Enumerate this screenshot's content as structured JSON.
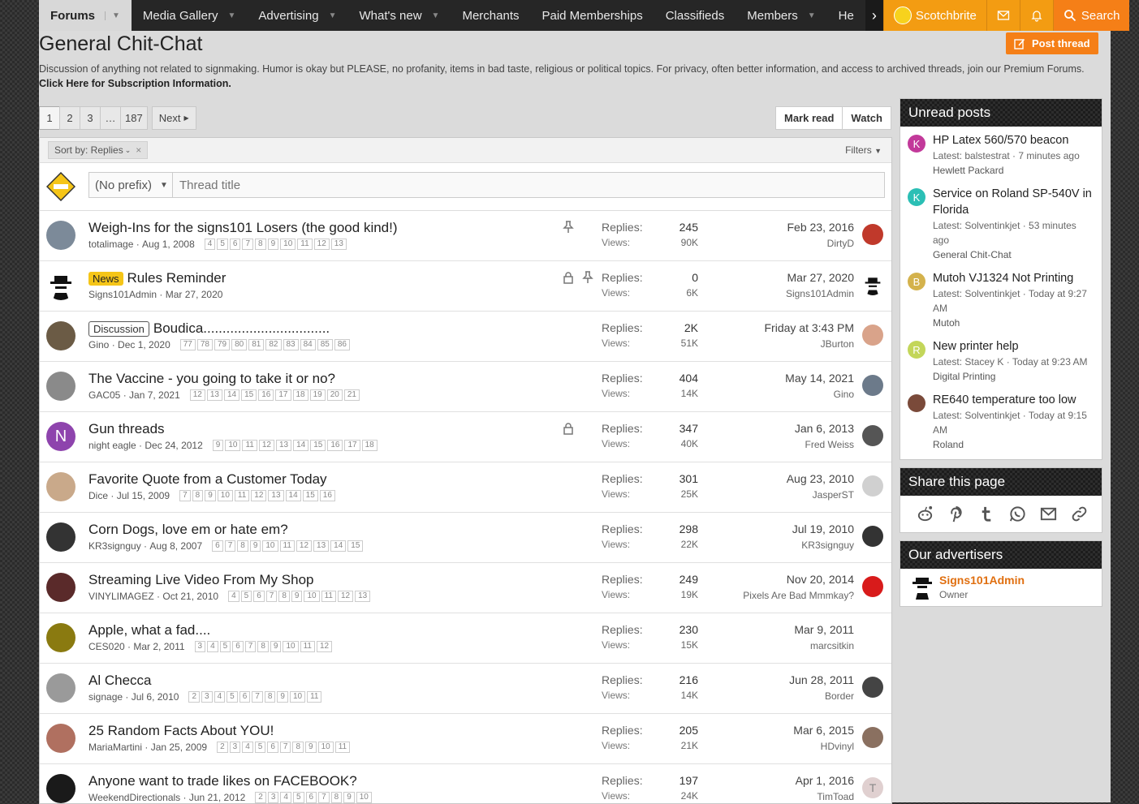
{
  "nav": {
    "tabs": [
      {
        "label": "Forums",
        "caret": true
      },
      {
        "label": "Media Gallery",
        "caret": true
      },
      {
        "label": "Advertising",
        "caret": true
      },
      {
        "label": "What's new",
        "caret": true
      },
      {
        "label": "Merchants",
        "caret": false
      },
      {
        "label": "Paid Memberships",
        "caret": false
      },
      {
        "label": "Classifieds",
        "caret": false
      },
      {
        "label": "Members",
        "caret": true
      },
      {
        "label": "He",
        "caret": false
      }
    ],
    "user": "Scotchbrite",
    "search_label": "Search",
    "accent_color": "#f39c12"
  },
  "page": {
    "title": "General Chit-Chat",
    "post_thread_label": "Post thread",
    "description": "Discussion of anything not related to signmaking. Humor is okay but PLEASE, no profanity, items in bad taste, religious or political topics. For privacy, often better information, and access to archived threads, join our Premium Forums.",
    "description_link": "Click Here for Subscription Information."
  },
  "pager": {
    "pages": [
      "1",
      "2",
      "3",
      "…",
      "187"
    ],
    "next_label": "Next"
  },
  "actions": {
    "mark_read": "Mark read",
    "watch": "Watch"
  },
  "filter_bar": {
    "sort_label": "Sort by: Replies",
    "filters_label": "Filters"
  },
  "quick_thread": {
    "prefix": "(No prefix)",
    "placeholder": "Thread title"
  },
  "stats_labels": {
    "replies": "Replies:",
    "views": "Views:"
  },
  "threads": [
    {
      "title": "Weigh-Ins for the signs101 Losers (the good kind!)",
      "label": "",
      "author": "totalimage",
      "date": "Aug 1, 2008",
      "pages": [
        "4",
        "5",
        "6",
        "7",
        "8",
        "9",
        "10",
        "11",
        "12",
        "13"
      ],
      "replies": "245",
      "views": "90K",
      "last_date": "Feb 23, 2016",
      "last_user": "DirtyD",
      "sticky": true,
      "locked": false,
      "avatar_color": "#7c8a99",
      "last_av_color": "#c0392b",
      "avatar_letter": "",
      "last_av_letter": ""
    },
    {
      "title": "Rules Reminder",
      "label": "News",
      "author": "Signs101Admin",
      "date": "Mar 27, 2020",
      "pages": [],
      "replies": "0",
      "views": "6K",
      "last_date": "Mar 27, 2020",
      "last_user": "Signs101Admin",
      "sticky": true,
      "locked": true,
      "avatar_color": "#ffffff",
      "last_av_color": "#ffffff",
      "avatar_letter": "",
      "last_av_letter": ""
    },
    {
      "title": "Boudica.................................",
      "label": "Discussion",
      "author": "Gino",
      "date": "Dec 1, 2020",
      "pages": [
        "77",
        "78",
        "79",
        "80",
        "81",
        "82",
        "83",
        "84",
        "85",
        "86"
      ],
      "replies": "2K",
      "views": "51K",
      "last_date": "Friday at 3:43 PM",
      "last_user": "JBurton",
      "sticky": false,
      "locked": false,
      "avatar_color": "#6b5b45",
      "last_av_color": "#d9a38a",
      "avatar_letter": "",
      "last_av_letter": ""
    },
    {
      "title": "The Vaccine - you going to take it or no?",
      "label": "",
      "author": "GAC05",
      "date": "Jan 7, 2021",
      "pages": [
        "12",
        "13",
        "14",
        "15",
        "16",
        "17",
        "18",
        "19",
        "20",
        "21"
      ],
      "replies": "404",
      "views": "14K",
      "last_date": "May 14, 2021",
      "last_user": "Gino",
      "sticky": false,
      "locked": false,
      "avatar_color": "#8a8a8a",
      "last_av_color": "#6c7a8a",
      "avatar_letter": "",
      "last_av_letter": ""
    },
    {
      "title": "Gun threads",
      "label": "",
      "author": "night eagle",
      "date": "Dec 24, 2012",
      "pages": [
        "9",
        "10",
        "11",
        "12",
        "13",
        "14",
        "15",
        "16",
        "17",
        "18"
      ],
      "replies": "347",
      "views": "40K",
      "last_date": "Jan 6, 2013",
      "last_user": "Fred Weiss",
      "sticky": false,
      "locked": true,
      "avatar_color": "#8e44ad",
      "last_av_color": "#555555",
      "avatar_letter": "N",
      "last_av_letter": ""
    },
    {
      "title": "Favorite Quote from a Customer Today",
      "label": "",
      "author": "Dice",
      "date": "Jul 15, 2009",
      "pages": [
        "7",
        "8",
        "9",
        "10",
        "11",
        "12",
        "13",
        "14",
        "15",
        "16"
      ],
      "replies": "301",
      "views": "25K",
      "last_date": "Aug 23, 2010",
      "last_user": "JasperST",
      "sticky": false,
      "locked": false,
      "avatar_color": "#c9a98a",
      "last_av_color": "#d0d0d0",
      "avatar_letter": "",
      "last_av_letter": ""
    },
    {
      "title": "Corn Dogs, love em or hate em?",
      "label": "",
      "author": "KR3signguy",
      "date": "Aug 8, 2007",
      "pages": [
        "6",
        "7",
        "8",
        "9",
        "10",
        "11",
        "12",
        "13",
        "14",
        "15"
      ],
      "replies": "298",
      "views": "22K",
      "last_date": "Jul 19, 2010",
      "last_user": "KR3signguy",
      "sticky": false,
      "locked": false,
      "avatar_color": "#333333",
      "last_av_color": "#333333",
      "avatar_letter": "",
      "last_av_letter": ""
    },
    {
      "title": "Streaming Live Video From My Shop",
      "label": "",
      "author": "VINYLIMAGEZ",
      "date": "Oct 21, 2010",
      "pages": [
        "4",
        "5",
        "6",
        "7",
        "8",
        "9",
        "10",
        "11",
        "12",
        "13"
      ],
      "replies": "249",
      "views": "19K",
      "last_date": "Nov 20, 2014",
      "last_user": "Pixels Are Bad Mmmkay?",
      "sticky": false,
      "locked": false,
      "avatar_color": "#5a2a2a",
      "last_av_color": "#d81b1b",
      "avatar_letter": "",
      "last_av_letter": ""
    },
    {
      "title": "Apple, what a fad....",
      "label": "",
      "author": "CES020",
      "date": "Mar 2, 2011",
      "pages": [
        "3",
        "4",
        "5",
        "6",
        "7",
        "8",
        "9",
        "10",
        "11",
        "12"
      ],
      "replies": "230",
      "views": "15K",
      "last_date": "Mar 9, 2011",
      "last_user": "marcsitkin",
      "sticky": false,
      "locked": false,
      "avatar_color": "#8a7a10",
      "last_av_color": "#ffffff",
      "avatar_letter": "",
      "last_av_letter": ""
    },
    {
      "title": "Al Checca",
      "label": "",
      "author": "signage",
      "date": "Jul 6, 2010",
      "pages": [
        "2",
        "3",
        "4",
        "5",
        "6",
        "7",
        "8",
        "9",
        "10",
        "11"
      ],
      "replies": "216",
      "views": "14K",
      "last_date": "Jun 28, 2011",
      "last_user": "Border",
      "sticky": false,
      "locked": false,
      "avatar_color": "#9a9a9a",
      "last_av_color": "#444444",
      "avatar_letter": "",
      "last_av_letter": ""
    },
    {
      "title": "25 Random Facts About YOU!",
      "label": "",
      "author": "MariaMartini",
      "date": "Jan 25, 2009",
      "pages": [
        "2",
        "3",
        "4",
        "5",
        "6",
        "7",
        "8",
        "9",
        "10",
        "11"
      ],
      "replies": "205",
      "views": "21K",
      "last_date": "Mar 6, 2015",
      "last_user": "HDvinyl",
      "sticky": false,
      "locked": false,
      "avatar_color": "#b07060",
      "last_av_color": "#8a7060",
      "avatar_letter": "",
      "last_av_letter": ""
    },
    {
      "title": "Anyone want to trade likes on FACEBOOK?",
      "label": "",
      "author": "WeekendDirectionals",
      "date": "Jun 21, 2012",
      "pages": [
        "2",
        "3",
        "4",
        "5",
        "6",
        "7",
        "8",
        "9",
        "10"
      ],
      "replies": "197",
      "views": "24K",
      "last_date": "Apr 1, 2016",
      "last_user": "TimToad",
      "sticky": false,
      "locked": false,
      "avatar_color": "#1a1a1a",
      "last_av_color": "#e0d0d0",
      "avatar_letter": "",
      "last_av_letter": "T"
    }
  ],
  "sidebar": {
    "unread_title": "Unread posts",
    "unread": [
      {
        "title": "HP Latex 560/570 beacon",
        "latest": "Latest: balstestrat · 7 minutes ago",
        "forum": "Hewlett Packard",
        "letter": "K",
        "color": "#c2399a"
      },
      {
        "title": "Service on Roland SP-540V in Florida",
        "latest": "Latest: Solventinkjet · 53 minutes ago",
        "forum": "General Chit-Chat",
        "letter": "K",
        "color": "#2bbfb5"
      },
      {
        "title": "Mutoh VJ1324 Not Printing",
        "latest": "Latest: Solventinkjet · Today at 9:27 AM",
        "forum": "Mutoh",
        "letter": "B",
        "color": "#d4b24c"
      },
      {
        "title": "New printer help",
        "latest": "Latest: Stacey K · Today at 9:23 AM",
        "forum": "Digital Printing",
        "letter": "R",
        "color": "#c3d65a"
      },
      {
        "title": "RE640 temperature too low",
        "latest": "Latest: Solventinkjet · Today at 9:15 AM",
        "forum": "Roland",
        "letter": "",
        "color": "#7a4a3a"
      }
    ],
    "share_title": "Share this page",
    "share_icons": [
      "reddit-icon",
      "pinterest-icon",
      "tumblr-icon",
      "whatsapp-icon",
      "email-icon",
      "link-icon"
    ],
    "advertisers_title": "Our advertisers",
    "advertiser": {
      "name": "Signs101Admin",
      "role": "Owner"
    }
  }
}
